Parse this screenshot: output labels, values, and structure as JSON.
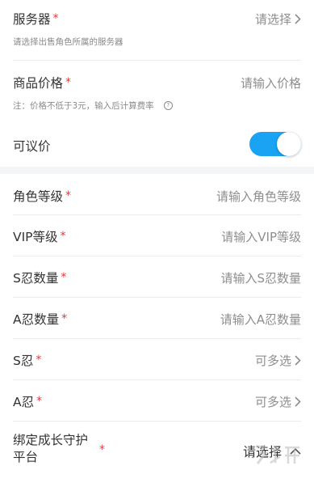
{
  "form": {
    "server": {
      "label": "服务器",
      "required": "*",
      "value": "请选择",
      "hint": "请选择出售角色所属的服务器"
    },
    "price": {
      "label": "商品价格",
      "required": "*",
      "placeholder": "请输入价格",
      "hint": "注：价格不低于3元，输入后计算费率"
    },
    "negotiable": {
      "label": "可议价",
      "enabled": true
    },
    "role_level": {
      "label": "角色等级",
      "required": "*",
      "placeholder": "请输入角色等级"
    },
    "vip_level": {
      "label": "VIP等级",
      "required": "*",
      "placeholder": "请输入VIP等级"
    },
    "s_ninja_count": {
      "label": "S忍数量",
      "required": "*",
      "placeholder": "请输入S忍数量"
    },
    "a_ninja_count": {
      "label": "A忍数量",
      "required": "*",
      "placeholder": "请输入A忍数量"
    },
    "s_ninja": {
      "label": "S忍",
      "required": "*",
      "value": "可多选"
    },
    "a_ninja": {
      "label": "A忍",
      "required": "*",
      "value": "可多选"
    },
    "bind_platform": {
      "label_line1": "绑定成长守护",
      "label_line2": "平台",
      "required": "*",
      "value": "请选择"
    }
  },
  "colors": {
    "accent": "#1aa3f2",
    "required": "#e8363b",
    "placeholder": "#8e8e8e"
  },
  "icons": {
    "chevron_right": "chevron-right-icon",
    "chevron_up": "chevron-up-icon",
    "help": "question-icon"
  }
}
